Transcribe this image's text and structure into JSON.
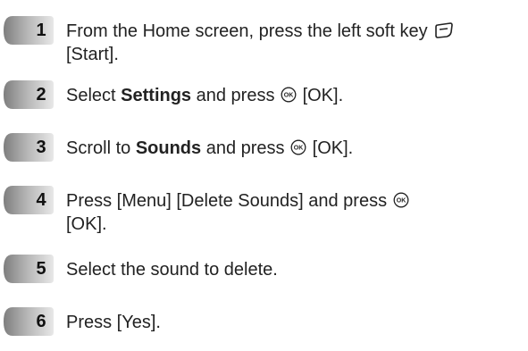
{
  "steps": [
    {
      "number": "1",
      "line1": "From the Home screen, press the left soft key",
      "softkey_icon": "left-soft-key-icon",
      "line2": "[Start]."
    },
    {
      "number": "2",
      "prefix": "Select ",
      "bold": "Settings",
      "middle": " and press",
      "ok_icon": "ok-key-icon",
      "suffix": " [OK]."
    },
    {
      "number": "3",
      "prefix": "Scroll to ",
      "bold": "Sounds",
      "middle": " and press",
      "ok_icon": "ok-key-icon",
      "suffix": " [OK]."
    },
    {
      "number": "4",
      "line1": "Press [Menu] [Delete Sounds] and press",
      "ok_icon": "ok-key-icon",
      "line2": "[OK]."
    },
    {
      "number": "5",
      "text": "Select the sound to delete."
    },
    {
      "number": "6",
      "text": "Press [Yes]."
    }
  ],
  "colors": {
    "badge_dark": "#8a8a8a",
    "badge_light": "#e6e6e6",
    "text": "#222222"
  }
}
